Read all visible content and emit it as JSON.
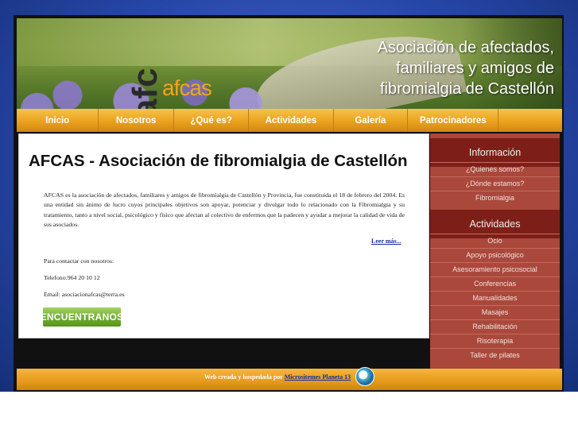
{
  "banner": {
    "logo_text": "afcas",
    "logo_mark": "afc",
    "title_line1": "Asociación de afectados,",
    "title_line2": "familiares y amigos de",
    "title_line3": "fibromialgia de Castellón"
  },
  "nav": {
    "items": [
      {
        "label": "Inicio"
      },
      {
        "label": "Nosotros"
      },
      {
        "label": "¿Qué es?"
      },
      {
        "label": "Actividades"
      },
      {
        "label": "Galería"
      },
      {
        "label": "Patrocinadores"
      },
      {
        "label": ""
      }
    ]
  },
  "main": {
    "title": "AFCAS - Asociación de fibromialgia de Castellón",
    "intro": "AFCAS es la asociación de afectados, familiares y amigos de fibromialgia de Castellón y Provincia, fue constituida el 18 de febrero del 2004. Es una entidad sin ánimo de lucro cuyos principales objetivos son apoyar, potenciar y divulgar todo lo relacionado con la Fibromialgia y su tratamiento, tanto a nivel social, psicológico y físico que afectan al colectivo de enfermos que la padecen y ayudar a mejorar la calidad de vida de sus asociados.",
    "read_more": "Leer más...",
    "contact_intro": "Para contactar con nosotros:",
    "phone": "Telefono:964 20 10 12",
    "email": "Email: asociacionafcas@terra.es",
    "find_button": "ENCUENTRANOS"
  },
  "sidebar": {
    "info_title": "Información",
    "info_items": [
      {
        "label": "¿Quienes somos?"
      },
      {
        "label": "¿Dónde estamos?"
      },
      {
        "label": "Fibromialgia"
      }
    ],
    "activities_title": "Actividades",
    "activity_items": [
      {
        "label": "Ocio"
      },
      {
        "label": "Apoyo psicológico"
      },
      {
        "label": "Asesoramiento psicosocial"
      },
      {
        "label": "Conferencias"
      },
      {
        "label": "Manualidades"
      },
      {
        "label": "Masajes"
      },
      {
        "label": "Rehabilitación"
      },
      {
        "label": "Risoterapia"
      },
      {
        "label": "Taller de pilates"
      }
    ]
  },
  "footer": {
    "text": "Web creada y hospedada por",
    "link": "Micrositemes Planeta 13"
  },
  "colors": {
    "nav": "#e9a21e",
    "sidebar": "#a9483b",
    "sidebar_head": "#7d1f18",
    "button": "#6cab2c",
    "background": "#2747a8"
  }
}
